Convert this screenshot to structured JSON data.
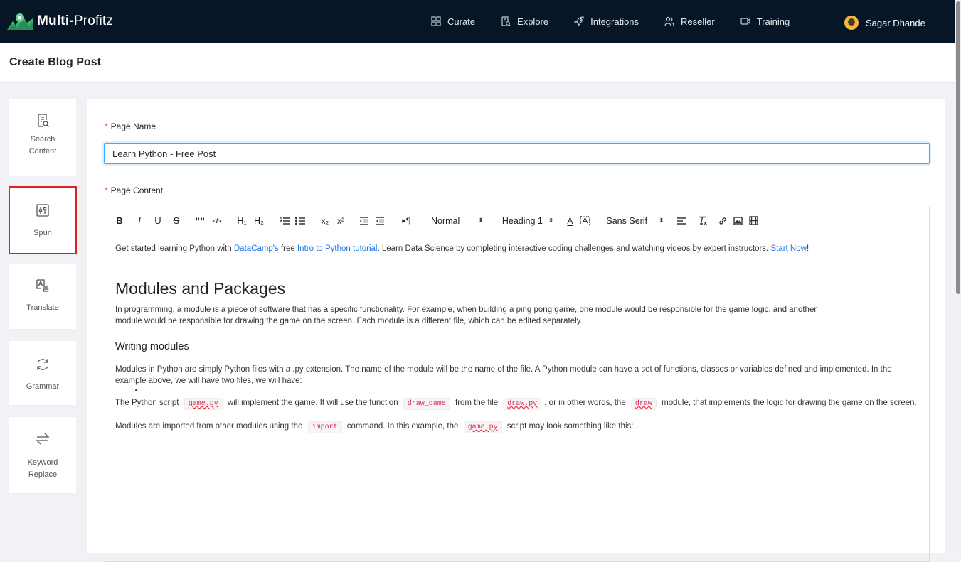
{
  "app": {
    "logo_bold": "Multi-",
    "logo_light": "Profitz"
  },
  "nav": {
    "items": [
      {
        "label": "Curate",
        "icon": "grid-icon"
      },
      {
        "label": "Explore",
        "icon": "doc-search-icon"
      },
      {
        "label": "Integrations",
        "icon": "rocket-icon"
      },
      {
        "label": "Reseller",
        "icon": "users-icon"
      },
      {
        "label": "Training",
        "icon": "video-icon"
      }
    ],
    "user_name": "Sagar Dhande"
  },
  "page": {
    "title": "Create Blog Post"
  },
  "tools": [
    {
      "label": "Search\nContent",
      "icon": "search-content-icon"
    },
    {
      "label": "Spun",
      "icon": "sliders-icon",
      "active": true
    },
    {
      "label": "Translate",
      "icon": "translate-icon"
    },
    {
      "label": "Grammar",
      "icon": "refresh-icon"
    },
    {
      "label": "Keyword\nReplace",
      "icon": "swap-arrows-icon"
    }
  ],
  "form": {
    "page_name_label": "Page Name",
    "page_name_value": "Learn Python - Free Post",
    "page_content_label": "Page Content"
  },
  "toolbar": {
    "bold": "B",
    "italic": "I",
    "underline": "U",
    "strike": "S",
    "quote": "””",
    "code": "</>",
    "h1": "H₁",
    "h2": "H₂",
    "sub": "x₂",
    "sup": "x²",
    "size_select": "Normal",
    "heading_select": "Heading 1",
    "font_select": "Sans Serif",
    "font_color": "A"
  },
  "content": {
    "intro_pre": "Get started learning Python with ",
    "intro_link1": "DataCamp's",
    "intro_mid1": " free ",
    "intro_link2": "Intro to Python tutorial",
    "intro_mid2": ". Learn Data Science by completing interactive coding challenges and watching videos by expert instructors. ",
    "intro_link3": "Start Now",
    "intro_end": "!",
    "h1": "Modules and Packages",
    "para1": "In programming, a module is a piece of software that has a specific functionality. For example, when building a ping pong game, one module would be responsible for the game logic, and another module would be responsible for drawing the game on the screen. Each module is a different file, which can be edited separately.",
    "h3": "Writing modules",
    "para2": "Modules in Python are simply Python files with a .py extension. The name of the module will be the name of the file. A Python module can have a set of functions, classes or variables defined and implemented. In the example above, we will have two files, we will have:",
    "para3_a": "The Python script ",
    "para3_code1": "game.py",
    "para3_b": " will implement the game. It will use the function ",
    "para3_code2": "draw_game",
    "para3_c": " from the file ",
    "para3_code3": "draw.py",
    "para3_d": ", or in other words, the ",
    "para3_code4": "draw",
    "para3_e": " module, that implements the logic for drawing the game on the screen.",
    "para4_a": "Modules are imported from other modules using the ",
    "para4_code1": "import",
    "para4_b": " command. In this example, the ",
    "para4_code2": "game.py",
    "para4_c": " script may look something like this:"
  },
  "colors": {
    "topbar": "#061627",
    "active_border": "#e02020",
    "link": "#1a73e8",
    "required": "#ff4d4f"
  }
}
